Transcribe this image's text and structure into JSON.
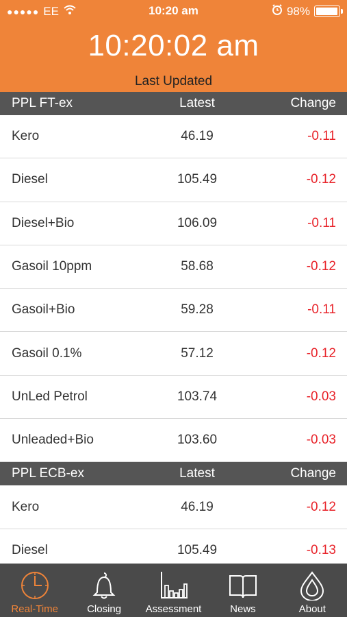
{
  "status_bar": {
    "carrier": "EE",
    "signal_dots": "●●●●●",
    "time": "10:20 am",
    "battery": "98%",
    "battery_level": 0.98
  },
  "header": {
    "clock": "10:20:02 am",
    "subtitle": "Last Updated"
  },
  "sections": [
    {
      "title": "PPL FT-ex",
      "col_latest": "Latest",
      "col_change": "Change",
      "rows": [
        {
          "name": "Kero",
          "latest": "46.19",
          "change": "-0.11"
        },
        {
          "name": "Diesel",
          "latest": "105.49",
          "change": "-0.12"
        },
        {
          "name": "Diesel+Bio",
          "latest": "106.09",
          "change": "-0.11"
        },
        {
          "name": "Gasoil 10ppm",
          "latest": "58.68",
          "change": "-0.12"
        },
        {
          "name": "Gasoil+Bio",
          "latest": "59.28",
          "change": "-0.11"
        },
        {
          "name": "Gasoil 0.1%",
          "latest": "57.12",
          "change": "-0.12"
        },
        {
          "name": "UnLed Petrol",
          "latest": "103.74",
          "change": "-0.03"
        },
        {
          "name": "Unleaded+Bio",
          "latest": "103.60",
          "change": "-0.03"
        }
      ]
    },
    {
      "title": "PPL ECB-ex",
      "col_latest": "Latest",
      "col_change": "Change",
      "rows": [
        {
          "name": "Kero",
          "latest": "46.19",
          "change": "-0.12"
        },
        {
          "name": "Diesel",
          "latest": "105.49",
          "change": "-0.13"
        }
      ]
    }
  ],
  "tabbar": {
    "tabs": [
      {
        "label": "Real-Time",
        "icon": "clock-icon",
        "active": true
      },
      {
        "label": "Closing",
        "icon": "bell-icon",
        "active": false
      },
      {
        "label": "Assessment",
        "icon": "bar-chart-icon",
        "active": false
      },
      {
        "label": "News",
        "icon": "book-icon",
        "active": false
      },
      {
        "label": "About",
        "icon": "drop-icon",
        "active": false
      }
    ]
  },
  "colors": {
    "accent": "#ef8439",
    "negative": "#e8232a",
    "section_header": "#555555",
    "tabbar": "#4a4a4a"
  }
}
